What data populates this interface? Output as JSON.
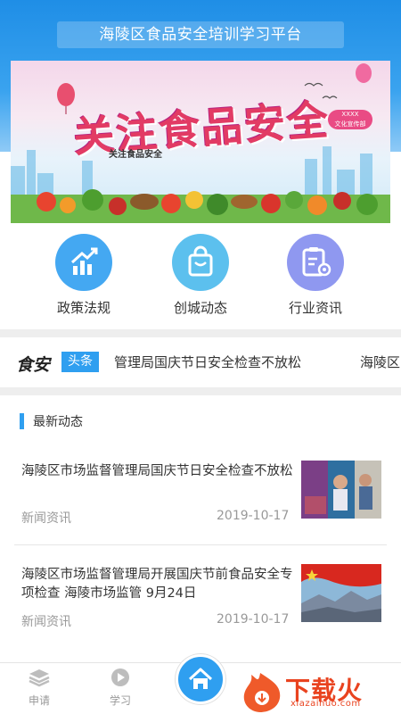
{
  "header": {
    "title": "海陵区食品安全培训学习平台"
  },
  "banner": {
    "headline": "关注食品安全",
    "subheadline": "关注食品安全",
    "badge": "XXXX\n文化宣传部"
  },
  "quick_nav": [
    {
      "label": "政策法规",
      "icon": "chart-up-icon",
      "color": "#44a8f2"
    },
    {
      "label": "创城动态",
      "icon": "shopping-bag-icon",
      "color": "#5cc0ee"
    },
    {
      "label": "行业资讯",
      "icon": "document-gear-icon",
      "color": "#8f98f0"
    }
  ],
  "ticker": {
    "brand": "食安",
    "tag": "头条",
    "text": "管理局国庆节日安全检查不放松",
    "next": "海陵区"
  },
  "section": {
    "title": "最新动态"
  },
  "news": [
    {
      "title": "海陵区市场监督管理局国庆节日安全检查不放松",
      "category": "新闻资讯",
      "date": "2019-10-17"
    },
    {
      "title": "海陵区市场监督管理局开展国庆节前食品安全专项检查 海陵市场监管 9月24日",
      "category": "新闻资讯",
      "date": "2019-10-17"
    }
  ],
  "tabbar": {
    "tabs": [
      {
        "label": "申请",
        "icon": "layers-icon"
      },
      {
        "label": "学习",
        "icon": "play-icon"
      }
    ],
    "home_icon": "home-icon"
  },
  "watermark": {
    "text": "下载火",
    "url": "xiazaihuo.com"
  },
  "colors": {
    "primary": "#2f9ff0",
    "header": "#1f8ee6",
    "muted": "#999999"
  }
}
